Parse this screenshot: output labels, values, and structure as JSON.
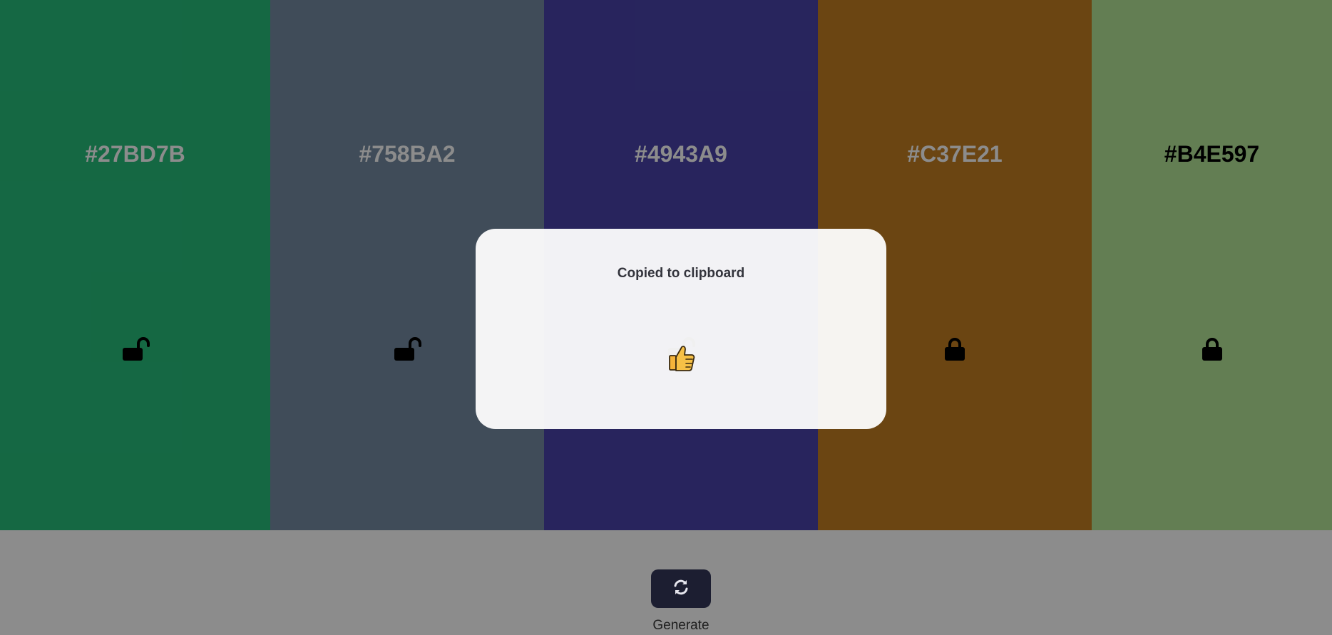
{
  "colors": [
    {
      "hex": "#27BD7B",
      "locked": false,
      "swatch": "#27BD7B",
      "label_color": "#ffffff"
    },
    {
      "hex": "#758BA2",
      "locked": false,
      "swatch": "#758BA2",
      "label_color": "#ffffff"
    },
    {
      "hex": "#4943A9",
      "locked": false,
      "swatch": "#4943A9",
      "label_color": "#ffffff"
    },
    {
      "hex": "#C37E21",
      "locked": true,
      "swatch": "#C37E21",
      "label_color": "#ffffff"
    },
    {
      "hex": "#B4E597",
      "locked": true,
      "swatch": "#B4E597",
      "label_color": "#000000"
    }
  ],
  "toast": {
    "message": "Copied to clipboard",
    "icon": "thumbs-up-icon"
  },
  "footer": {
    "generate_label": "Generate",
    "generate_icon": "refresh-icon",
    "button_color": "#1c1e31"
  }
}
